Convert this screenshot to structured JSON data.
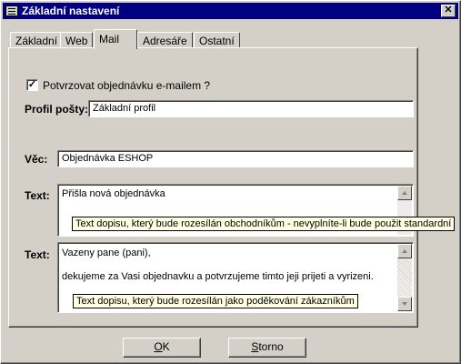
{
  "window": {
    "title": "Základní nastavení",
    "close_glyph": "✕"
  },
  "tabs": [
    {
      "label": "Základní"
    },
    {
      "label": "Web"
    },
    {
      "label": "Mail"
    },
    {
      "label": "Adresáře"
    },
    {
      "label": "Ostatní"
    }
  ],
  "active_tab": "Mail",
  "mail": {
    "confirm_checkbox": {
      "checked": true,
      "glyph": "✓",
      "label": "Potvrzovat objednávku e-mailem ?"
    },
    "profile": {
      "label": "Profil pošty:",
      "value": "Základní profil"
    },
    "subject": {
      "label": "Věc:",
      "value": "Objednávka ESHOP"
    },
    "text1": {
      "label": "Text:",
      "lines": [
        "Přišla nová objednávka"
      ],
      "tooltip": "Text dopisu, který bude rozesílán obchodníkům - nevyplníte-li bude použit standardní"
    },
    "text2": {
      "label": "Text:",
      "lines": [
        "Vazeny pane (pani),",
        "dekujeme za Vasi objednavku a potvrzujeme timto jeji prijeti a vyrizeni."
      ],
      "tooltip": "Text dopisu, který bude rozesílán jako poděkování zákazníkům"
    }
  },
  "buttons": {
    "ok": {
      "mnemonic": "O",
      "rest": "K"
    },
    "cancel": {
      "mnemonic": "S",
      "rest": "torno"
    }
  },
  "colors": {
    "titlebar": "#000080",
    "face": "#d4d0c8",
    "tooltip_bg": "#ffffe1"
  }
}
